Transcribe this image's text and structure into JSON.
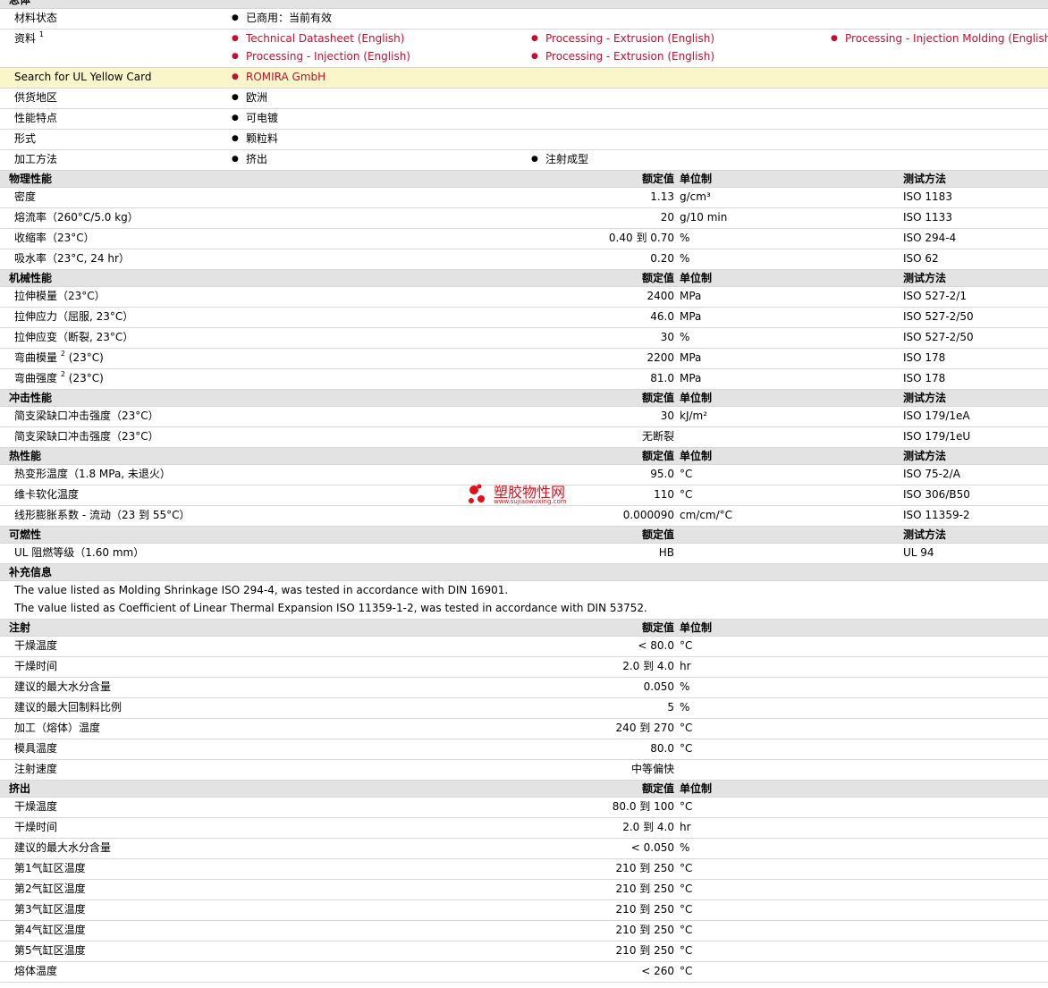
{
  "general": {
    "title": "总体",
    "status_label": "材料状态",
    "status_value": "已商用：当前有效",
    "docs_label": "资料",
    "docs_sup": "1",
    "docs": [
      "Technical Datasheet (English)",
      "Processing - Extrusion (English)",
      "Processing - Injection Molding (English)",
      "Processing - Injection (English)",
      "Processing - Extrusion (English)"
    ],
    "ul_label": "Search for UL Yellow Card",
    "ul_value": "ROMIRA GmbH",
    "region_label": "供货地区",
    "region_value": "欧洲",
    "features_label": "性能特点",
    "features_value": "可电镀",
    "form_label": "形式",
    "form_value": "颗粒料",
    "method_label": "加工方法",
    "method_values": [
      "挤出",
      "注射成型"
    ]
  },
  "headers": {
    "nominal": "额定值",
    "unit": "单位制",
    "method": "测试方法"
  },
  "physical": {
    "title": "物理性能",
    "rows": [
      {
        "label": "密度",
        "value": "1.13",
        "unit": "g/cm³",
        "method": "ISO 1183"
      },
      {
        "label": "熔流率（260°C/5.0 kg）",
        "value": "20",
        "unit": "g/10 min",
        "method": "ISO 1133"
      },
      {
        "label": "收缩率（23°C）",
        "value": "0.40 到  0.70",
        "unit": "%",
        "method": "ISO 294-4"
      },
      {
        "label": "吸水率（23°C, 24 hr）",
        "value": "0.20",
        "unit": "%",
        "method": "ISO 62"
      }
    ]
  },
  "mechanical": {
    "title": "机械性能",
    "rows": [
      {
        "label": "拉伸模量（23°C）",
        "value": "2400",
        "unit": "MPa",
        "method": "ISO 527-2/1"
      },
      {
        "label": "拉伸应力（屈服, 23°C）",
        "value": "46.0",
        "unit": "MPa",
        "method": "ISO 527-2/50"
      },
      {
        "label": "拉伸应变（断裂, 23°C）",
        "value": "30",
        "unit": "%",
        "method": "ISO 527-2/50"
      },
      {
        "label": "弯曲模量",
        "sup": "2",
        "label2": "(23°C)",
        "value": "2200",
        "unit": "MPa",
        "method": "ISO 178"
      },
      {
        "label": "弯曲强度",
        "sup": "2",
        "label2": "(23°C)",
        "value": "81.0",
        "unit": "MPa",
        "method": "ISO 178"
      }
    ]
  },
  "impact": {
    "title": "冲击性能",
    "rows": [
      {
        "label": "简支梁缺口冲击强度（23°C）",
        "value": "30",
        "unit": "kJ/m²",
        "method": "ISO 179/1eA"
      },
      {
        "label": "简支梁缺口冲击强度（23°C）",
        "value": "无断裂",
        "unit": "",
        "method": "ISO 179/1eU"
      }
    ]
  },
  "thermal": {
    "title": "热性能",
    "rows": [
      {
        "label": "热变形温度（1.8 MPa, 未退火）",
        "value": "95.0",
        "unit": "°C",
        "method": "ISO 75-2/A"
      },
      {
        "label": "维卡软化温度",
        "value": "110",
        "unit": "°C",
        "method": "ISO 306/B50"
      },
      {
        "label": "线形膨胀系数  - 流动（23 到  55°C）",
        "value": "0.000090",
        "unit": "cm/cm/°C",
        "method": "ISO 11359-2"
      }
    ]
  },
  "flammability": {
    "title": "可燃性",
    "rows": [
      {
        "label": "UL 阻燃等级（1.60 mm）",
        "value": "HB",
        "unit": "",
        "method": "UL 94"
      }
    ]
  },
  "supplement": {
    "title": "补充信息",
    "notes": [
      "The value listed as Molding Shrinkage ISO 294-4, was tested in accordance with DIN 16901.",
      "The value listed as Coefficient of Linear Thermal Expansion ISO 11359-1-2, was tested in accordance with DIN 53752."
    ]
  },
  "injection": {
    "title": "注射",
    "rows": [
      {
        "label": "干燥温度",
        "value": "< 80.0",
        "unit": "°C"
      },
      {
        "label": "干燥时间",
        "value": "2.0 到  4.0",
        "unit": "hr"
      },
      {
        "label": "建议的最大水分含量",
        "value": "0.050",
        "unit": "%"
      },
      {
        "label": "建议的最大回制料比例",
        "value": "5",
        "unit": "%"
      },
      {
        "label": "加工（熔体）温度",
        "value": "240 到  270",
        "unit": "°C"
      },
      {
        "label": "模具温度",
        "value": "80.0",
        "unit": "°C"
      },
      {
        "label": "注射速度",
        "value": "中等偏快",
        "unit": ""
      }
    ]
  },
  "extrusion": {
    "title": "挤出",
    "rows": [
      {
        "label": "干燥温度",
        "value": "80.0 到  100",
        "unit": "°C"
      },
      {
        "label": "干燥时间",
        "value": "2.0 到  4.0",
        "unit": "hr"
      },
      {
        "label": "建议的最大水分含量",
        "value": "< 0.050",
        "unit": "%"
      },
      {
        "label": "第1气缸区温度",
        "value": "210 到  250",
        "unit": "°C"
      },
      {
        "label": "第2气缸区温度",
        "value": "210 到  250",
        "unit": "°C"
      },
      {
        "label": "第3气缸区温度",
        "value": "210 到  250",
        "unit": "°C"
      },
      {
        "label": "第4气缸区温度",
        "value": "210 到  250",
        "unit": "°C"
      },
      {
        "label": "第5气缸区温度",
        "value": "210 到  250",
        "unit": "°C"
      },
      {
        "label": "熔体温度",
        "value": "< 260",
        "unit": "°C"
      }
    ]
  },
  "watermark": {
    "brand": "塑胶物性网",
    "url": "www.sujiaowuxing.com",
    "color": "#e0101a"
  },
  "colors": {
    "link": "#c0102f",
    "section_bg": "#e3e3e3",
    "highlight_bg": "#fbf6ca"
  }
}
